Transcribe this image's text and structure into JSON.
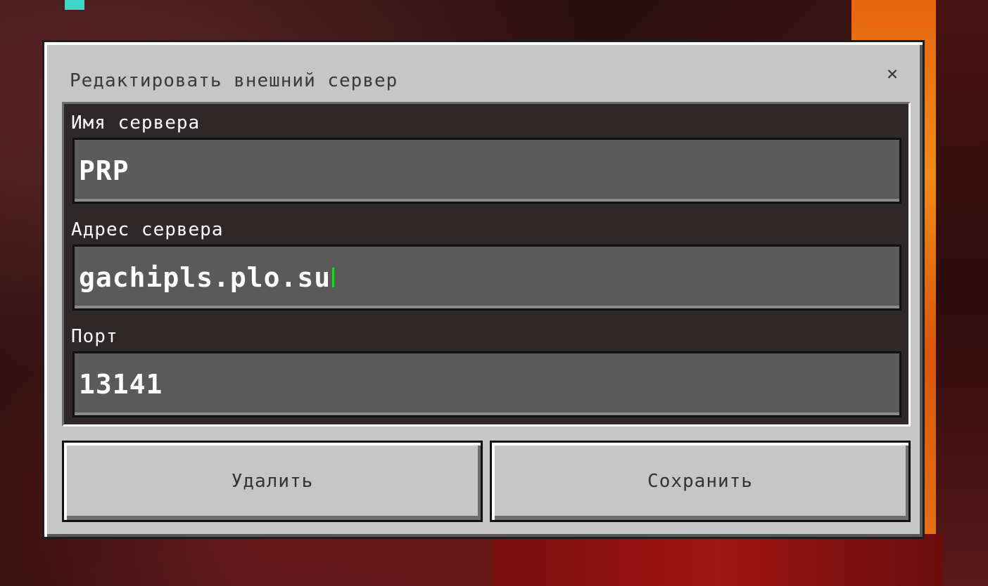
{
  "dialog": {
    "title": "Редактировать внешний сервер",
    "close_icon": "×"
  },
  "fields": [
    {
      "label": "Имя сервера",
      "value": "PRP"
    },
    {
      "label": "Адрес сервера",
      "value": "gachipls.plo.su"
    },
    {
      "label": "Порт",
      "value": "13141"
    }
  ],
  "buttons": {
    "delete_label": "Удалить",
    "save_label": "Сохранить"
  },
  "colors": {
    "panel": "#c6c6c6",
    "input": "#5a5a5a",
    "cursor": "#22d22a"
  }
}
